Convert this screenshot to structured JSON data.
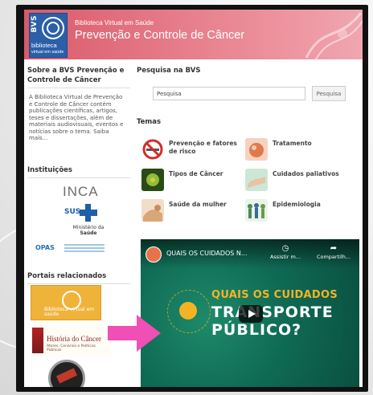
{
  "header": {
    "logo_letters": "BVS",
    "logo_word": "biblioteca",
    "logo_sub": "virtual em saúde",
    "site_small": "Biblioteca Virtual em Saúde",
    "site_title": "Prevenção e Controle de Câncer"
  },
  "sidebar": {
    "about_title": "Sobre a BVS Prevenção e Controle de Câncer",
    "about_text": "A Biblioteca Virtual de Prevenção e Controle de Câncer contém publicações científicas, artigos, teses e dissertações, além de materiais audiovisuais, eventos e notícias sobre o tema. Saiba mais...",
    "institutions_title": "Instituições",
    "inca": "INCA",
    "sus": "SUS",
    "ministerio_line1": "Ministério da",
    "ministerio_line2": "Saúde",
    "opas": "OPAS",
    "portals_title": "Portais relacionados",
    "portal1_text": "Biblioteca virtual em saúde",
    "portal2_title": "História do Câncer",
    "portal2_sub": "Atores, Cenários e Políticas Públicas"
  },
  "search": {
    "title": "Pesquisa na BVS",
    "placeholder": "Pesquisa",
    "button_label": "Pesquisa"
  },
  "temas": {
    "title": "Temas",
    "items": [
      {
        "label": "Prevenção e fatores de risco",
        "icon": "no-smoking-icon"
      },
      {
        "label": "Tratamento",
        "icon": "treatment-icon"
      },
      {
        "label": "Tipos de Câncer",
        "icon": "cell-icon"
      },
      {
        "label": "Cuidados paliativos",
        "icon": "hands-icon"
      },
      {
        "label": "Saúde da mulher",
        "icon": "woman-icon"
      },
      {
        "label": "Epidemiologia",
        "icon": "people-icon"
      }
    ]
  },
  "video": {
    "title": "QUAIS OS CUIDADOS N...",
    "watch_label": "Assistir m...",
    "share_label": "Compartilh...",
    "headline1": "QUAIS OS CUIDADOS",
    "headline2": "TRANSPORTE",
    "headline3": "PÚBLICO?"
  },
  "colors": {
    "header": "#e98390",
    "video_bg": "#0f6b55",
    "accent_yellow": "#f5b324",
    "arrow_pink": "#f04fb5"
  }
}
